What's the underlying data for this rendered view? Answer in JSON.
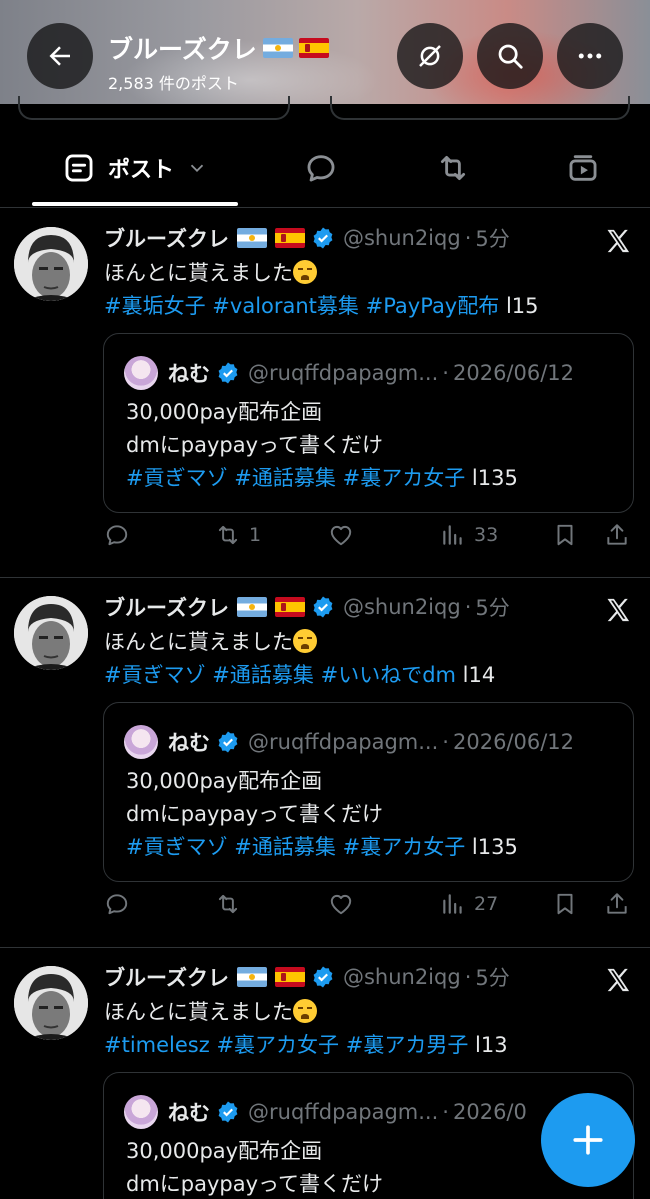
{
  "header": {
    "title": "ブルーズクレ",
    "post_count": "2,583 件のポスト",
    "flags": [
      "argentina-flag",
      "spain-flag"
    ]
  },
  "tabs": {
    "active_label": "ポスト",
    "items": [
      "posts",
      "replies",
      "reposts",
      "media"
    ]
  },
  "posts": [
    {
      "name": "ブルーズクレ",
      "handle": "@shun2iqg",
      "time": "5分",
      "text": "ほんとに貰えました",
      "hashtags": [
        "#裏垢女子",
        "#valorant募集",
        "#PayPay配布"
      ],
      "suffix": "l15",
      "quote": {
        "name": "ねむ",
        "handle": "@ruqffdpapagm...",
        "date": "2026/06/12",
        "line1": "30,000pay配布企画",
        "line2": "dmにpaypayって書くだけ",
        "hashtags": [
          "#貢ぎマゾ",
          "#通話募集",
          "#裏アカ女子"
        ],
        "suffix": "l135"
      },
      "reposts": "1",
      "views": "33"
    },
    {
      "name": "ブルーズクレ",
      "handle": "@shun2iqg",
      "time": "5分",
      "text": "ほんとに貰えました",
      "hashtags": [
        "#貢ぎマゾ",
        "#通話募集",
        "#いいねでdm"
      ],
      "suffix": "l14",
      "quote": {
        "name": "ねむ",
        "handle": "@ruqffdpapagm...",
        "date": "2026/06/12",
        "line1": "30,000pay配布企画",
        "line2": "dmにpaypayって書くだけ",
        "hashtags": [
          "#貢ぎマゾ",
          "#通話募集",
          "#裏アカ女子"
        ],
        "suffix": "l135"
      },
      "reposts": "",
      "views": "27"
    },
    {
      "name": "ブルーズクレ",
      "handle": "@shun2iqg",
      "time": "5分",
      "text": "ほんとに貰えました",
      "hashtags": [
        "#timelesz",
        "#裏アカ女子",
        "#裏アカ男子"
      ],
      "suffix": "l13",
      "quote": {
        "name": "ねむ",
        "handle": "@ruqffdpapagm...",
        "date": "2026/0",
        "line1": "30,000pay配布企画",
        "line2": "dmにpaypayって書くだけ"
      }
    }
  ],
  "colors": {
    "accent": "#1d9bf0",
    "background": "#000000",
    "muted": "#71767b",
    "border": "#2f3336"
  }
}
